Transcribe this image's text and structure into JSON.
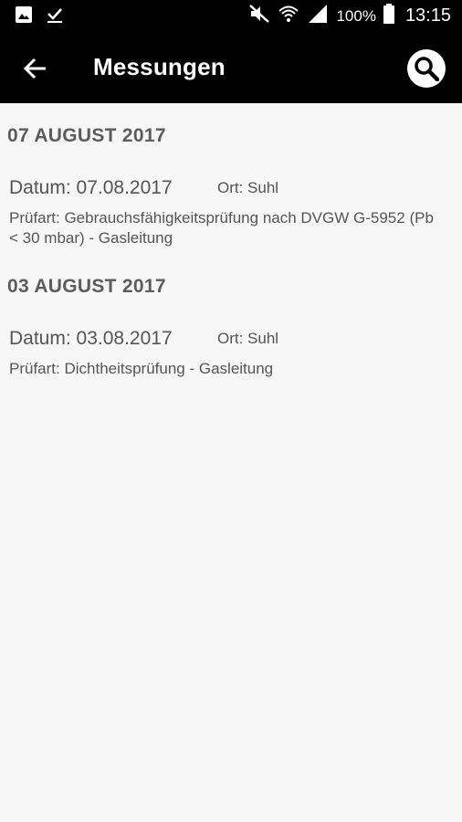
{
  "status_bar": {
    "icons_left": [
      "image-icon",
      "checkmark-icon"
    ],
    "icons_right": [
      "mute-icon",
      "wifi-icon",
      "signal-icon"
    ],
    "battery_text": "100%",
    "time": "13:15"
  },
  "app_bar": {
    "back_icon": "arrow-left-icon",
    "title": "Messungen",
    "search_icon": "search-icon"
  },
  "sections": [
    {
      "header": "07 AUGUST 2017",
      "entry": {
        "datum": "Datum: 07.08.2017",
        "ort": "Ort: Suhl",
        "pruefart": "Prüfart: Gebrauchsfähigkeitsprüfung nach  DVGW G-5952 (Pb < 30 mbar) - Gasleitung"
      }
    },
    {
      "header": "03 AUGUST 2017",
      "entry": {
        "datum": "Datum: 03.08.2017",
        "ort": "Ort: Suhl",
        "pruefart": "Prüfart: Dichtheitsprüfung - Gasleitung"
      }
    }
  ],
  "colors": {
    "bar_background": "#000000",
    "page_background": "#f7f7f7",
    "text": "#555555",
    "section_header": "#5c5c5c"
  }
}
